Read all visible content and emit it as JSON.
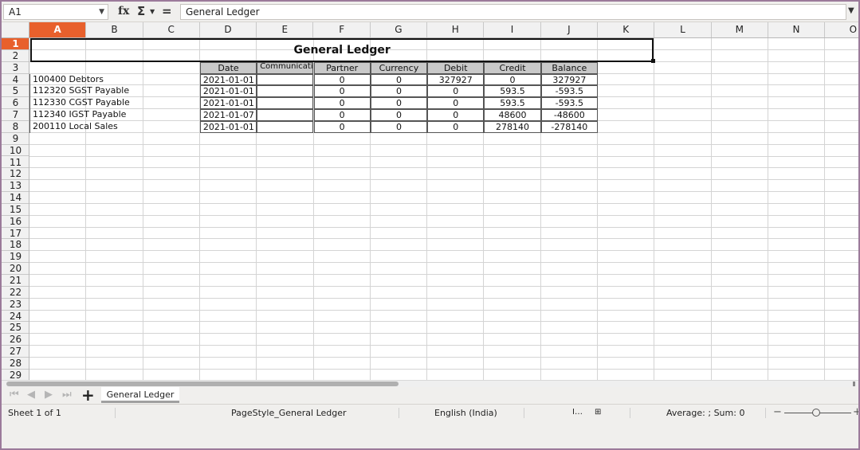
{
  "formula_bar": {
    "name_box": "A1",
    "fx_label": "fx",
    "sigma_label": "Σ",
    "equals_label": "=",
    "formula": "General Ledger"
  },
  "columns": [
    "A",
    "B",
    "C",
    "D",
    "E",
    "F",
    "G",
    "H",
    "I",
    "J",
    "K",
    "L",
    "M",
    "N",
    "O"
  ],
  "selected_column": "A",
  "rows": [
    "1",
    "2",
    "3",
    "4",
    "5",
    "6",
    "7",
    "8",
    "9",
    "10",
    "11",
    "12",
    "13",
    "14",
    "15",
    "16",
    "17",
    "18",
    "19",
    "20",
    "21",
    "22",
    "23",
    "24",
    "25",
    "26",
    "27",
    "28",
    "29"
  ],
  "selected_row": "1",
  "sheet": {
    "title": "General Ledger",
    "headers": [
      "Date",
      "Communication",
      "Partner",
      "Currency",
      "Debit",
      "Credit",
      "Balance"
    ],
    "header_visible": [
      "Date",
      "Communica-tion",
      "Partner",
      "Currency",
      "Debit",
      "Credit",
      "Balance"
    ],
    "data": [
      {
        "account": "100400 Debtors",
        "date": "2021-01-01",
        "comm": "",
        "partner": "0",
        "currency": "0",
        "debit": "327927",
        "credit": "0",
        "balance": "327927"
      },
      {
        "account": "112320 SGST Payable",
        "date": "2021-01-01",
        "comm": "",
        "partner": "0",
        "currency": "0",
        "debit": "0",
        "credit": "593.5",
        "balance": "-593.5"
      },
      {
        "account": "112330 CGST Payable",
        "date": "2021-01-01",
        "comm": "",
        "partner": "0",
        "currency": "0",
        "debit": "0",
        "credit": "593.5",
        "balance": "-593.5"
      },
      {
        "account": "112340 IGST Payable",
        "date": "2021-01-07",
        "comm": "",
        "partner": "0",
        "currency": "0",
        "debit": "0",
        "credit": "48600",
        "balance": "-48600"
      },
      {
        "account": "200110 Local Sales",
        "date": "2021-01-01",
        "comm": "",
        "partner": "0",
        "currency": "0",
        "debit": "0",
        "credit": "278140",
        "balance": "-278140"
      }
    ]
  },
  "tabs": {
    "sheet_tab": "General Ledger"
  },
  "status_bar": {
    "sheet_pos": "Sheet 1 of 1",
    "page_style": "PageStyle_General Ledger",
    "language": "English (India)",
    "summary": "Average: ; Sum: 0"
  },
  "colors": {
    "selection_accent": "#e8602c",
    "header_fill": "#c9c9c9",
    "window_border": "#9b7a9a"
  }
}
